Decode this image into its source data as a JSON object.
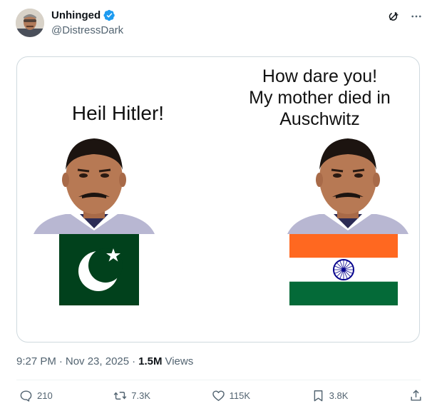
{
  "author": {
    "display_name": "Unhinged",
    "handle": "@DistressDark",
    "verified": true
  },
  "media": {
    "left_caption": "Heil Hitler!",
    "right_caption_lines": [
      "How dare you!",
      "My mother died in",
      "Auschwitz"
    ],
    "left_flag": "pakistan-flag",
    "right_flag": "india-flag"
  },
  "meta": {
    "time": "9:27 PM",
    "separator1": "·",
    "date": "Nov 23, 2025",
    "separator2": "·",
    "views_count": "1.5M",
    "views_label": "Views"
  },
  "actions": {
    "replies": "210",
    "reposts": "7.3K",
    "likes": "115K",
    "bookmarks": "3.8K"
  },
  "icons": {
    "verified": "verified-badge-icon",
    "grok": "grok-icon",
    "more": "more-icon",
    "reply": "reply-icon",
    "repost": "repost-icon",
    "like": "like-icon",
    "bookmark": "bookmark-icon",
    "share": "share-icon"
  },
  "colors": {
    "accent": "#1d9bf0",
    "text_secondary": "#536471",
    "pakistan_green": "#01411c",
    "india_saffron": "#ff6820",
    "india_green": "#046a38",
    "chakra_blue": "#06038d"
  }
}
